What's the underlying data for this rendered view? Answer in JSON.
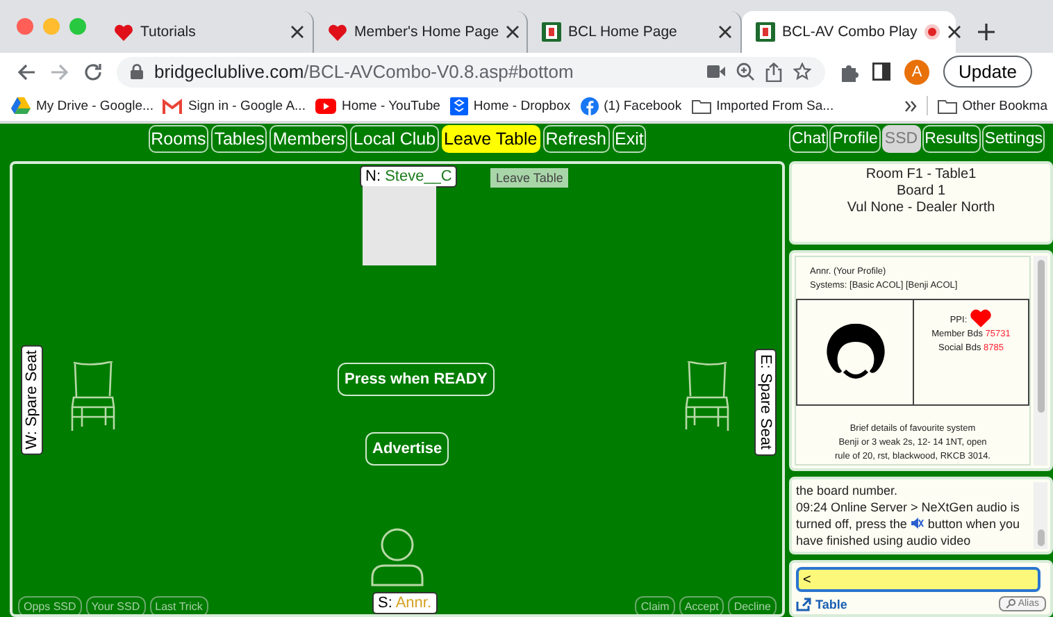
{
  "browser": {
    "tabs": [
      {
        "title": "Tutorials",
        "kind": "heart",
        "selected": false,
        "recording": false
      },
      {
        "title": "Member's Home Page",
        "kind": "heart",
        "selected": false,
        "recording": false
      },
      {
        "title": "BCL Home Page",
        "kind": "club",
        "selected": false,
        "recording": false
      },
      {
        "title": "BCL-AV Combo Play",
        "kind": "club",
        "selected": true,
        "recording": true
      }
    ],
    "url_host": "bridgeclublive.com",
    "url_path": "/BCL-AVCombo-V0.8.asp#bottom",
    "profile_initial": "A",
    "update_button": "Update",
    "bookmarks": [
      {
        "label": "My Drive - Google...",
        "kind": "drive"
      },
      {
        "label": "Sign in - Google A...",
        "kind": "mail"
      },
      {
        "label": "Home - YouTube",
        "kind": "video"
      },
      {
        "label": "Home - Dropbox",
        "kind": "box"
      },
      {
        "label": "(1) Facebook",
        "kind": "social"
      },
      {
        "label": "Imported From Sa...",
        "kind": "folder"
      }
    ],
    "other_bookmarks": "Other Bookma"
  },
  "nav": {
    "left": [
      {
        "label": "Rooms",
        "selected": false,
        "disabled": false
      },
      {
        "label": "Tables",
        "selected": false,
        "disabled": false
      },
      {
        "label": "Members",
        "selected": false,
        "disabled": false
      },
      {
        "label": "Local Club",
        "selected": false,
        "disabled": false
      },
      {
        "label": "Leave Table",
        "selected": true,
        "disabled": false
      },
      {
        "label": "Refresh",
        "selected": false,
        "disabled": false
      },
      {
        "label": "Exit",
        "selected": false,
        "disabled": false
      }
    ],
    "right": [
      {
        "label": "Chat",
        "selected": false,
        "disabled": false
      },
      {
        "label": "Profile",
        "selected": false,
        "disabled": false
      },
      {
        "label": "SSD",
        "selected": false,
        "disabled": true
      },
      {
        "label": "Results",
        "selected": false,
        "disabled": false
      },
      {
        "label": "Settings",
        "selected": false,
        "disabled": false
      }
    ]
  },
  "table": {
    "north": {
      "seat": "N:",
      "name": "Steve__C"
    },
    "tooltip": "Leave Table",
    "west": "W: Spare Seat",
    "east": "E: Spare Seat",
    "ready_button": "Press when READY",
    "advertise_button": "Advertise",
    "south": {
      "seat": "S:",
      "name": "Annr."
    },
    "left_buttons": [
      "Opps SSD",
      "Your SSD",
      "Last Trick"
    ],
    "right_buttons": [
      "Claim",
      "Accept",
      "Decline"
    ]
  },
  "info": [
    "Room F1 - Table1",
    "Board 1",
    "Vul None - Dealer North"
  ],
  "profile": {
    "title": "Annr. (Your Profile)",
    "systems": "Systems: [Basic ACOL]  [Benji ACOL]",
    "ppi": "PPI:",
    "stats": [
      {
        "label": "Member Bds",
        "value": "75731"
      },
      {
        "label": "Social Bds",
        "value": "8785"
      }
    ],
    "description": [
      "Brief details of favourite system",
      "Benji or 3 weak 2s, 12- 14 1NT, open",
      "rule of 20, rst, blackwood, RKCB 3014."
    ]
  },
  "chat": {
    "messages": [
      {
        "before": "the board number."
      },
      {
        "before": "09:24 Online Server > NeXtGen audio is turned off, press the",
        "after": "button when you have finished using audio video"
      }
    ],
    "input_value": "<",
    "table_link": "Table",
    "alias_button": "Alias"
  }
}
